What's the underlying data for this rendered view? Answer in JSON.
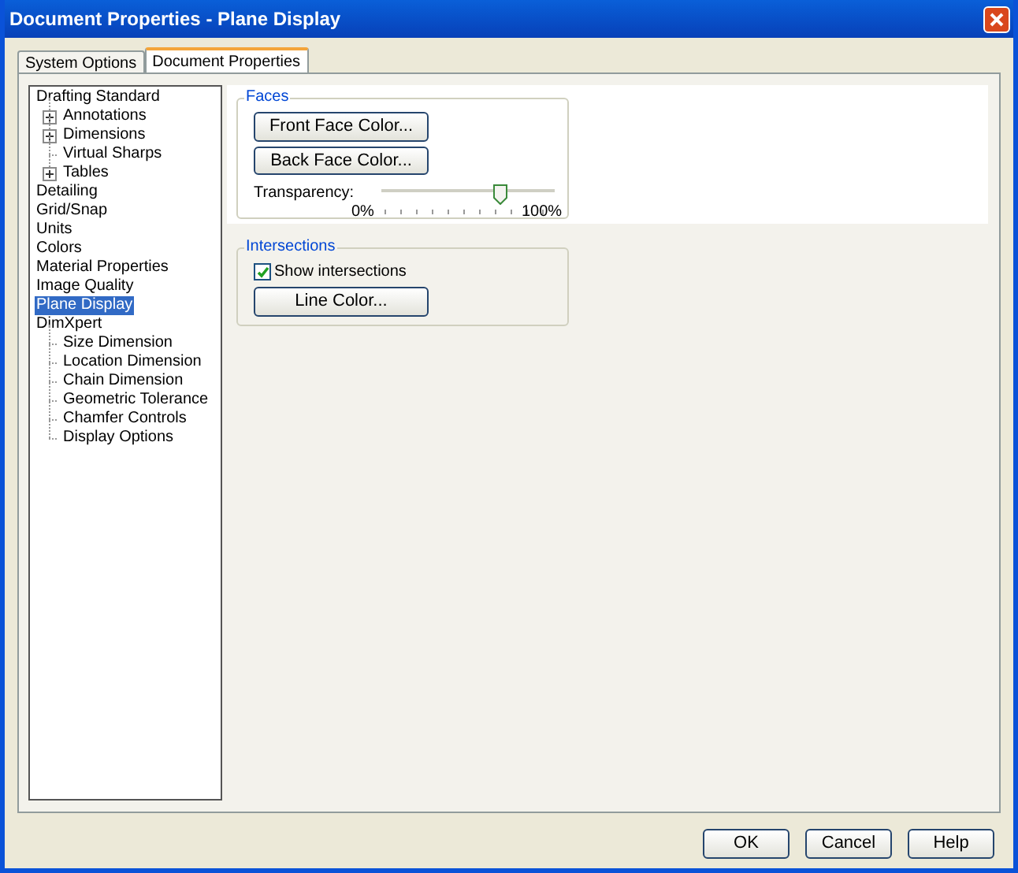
{
  "window": {
    "title": "Document Properties - Plane Display"
  },
  "tabs": [
    {
      "label": "System Options",
      "selected": false
    },
    {
      "label": "Document Properties",
      "selected": true
    }
  ],
  "tree": [
    {
      "label": "Drafting Standard",
      "selected": false,
      "children": [
        {
          "label": "Annotations",
          "kind": "collapsed",
          "selected": false
        },
        {
          "label": "Dimensions",
          "kind": "collapsed",
          "selected": false
        },
        {
          "label": "Virtual Sharps",
          "kind": "leaf",
          "selected": false
        },
        {
          "label": "Tables",
          "kind": "collapsed",
          "selected": false
        }
      ]
    },
    {
      "label": "Detailing",
      "selected": false
    },
    {
      "label": "Grid/Snap",
      "selected": false
    },
    {
      "label": "Units",
      "selected": false
    },
    {
      "label": "Colors",
      "selected": false
    },
    {
      "label": "Material Properties",
      "selected": false
    },
    {
      "label": "Image Quality",
      "selected": false
    },
    {
      "label": "Plane Display",
      "selected": true
    },
    {
      "label": "DimXpert",
      "selected": false,
      "children": [
        {
          "label": "Size Dimension",
          "kind": "leaf",
          "selected": false
        },
        {
          "label": "Location Dimension",
          "kind": "leaf",
          "selected": false
        },
        {
          "label": "Chain Dimension",
          "kind": "leaf",
          "selected": false
        },
        {
          "label": "Geometric Tolerance",
          "kind": "leaf",
          "selected": false
        },
        {
          "label": "Chamfer Controls",
          "kind": "leaf",
          "selected": false
        },
        {
          "label": "Display Options",
          "kind": "leaf",
          "selected": false
        }
      ]
    }
  ],
  "faces": {
    "title": "Faces",
    "buttons": [
      "Front Face Color...",
      "Back Face Color..."
    ],
    "transparency": {
      "label": "Transparency:",
      "min_label": "0%",
      "max_label": "100%",
      "level": 0.7
    }
  },
  "intersections": {
    "title": "Intersections",
    "checkbox": {
      "label": "Show intersections",
      "checked": true
    },
    "button": "Line Color..."
  },
  "buttons": [
    "OK",
    "Cancel",
    "Help"
  ]
}
